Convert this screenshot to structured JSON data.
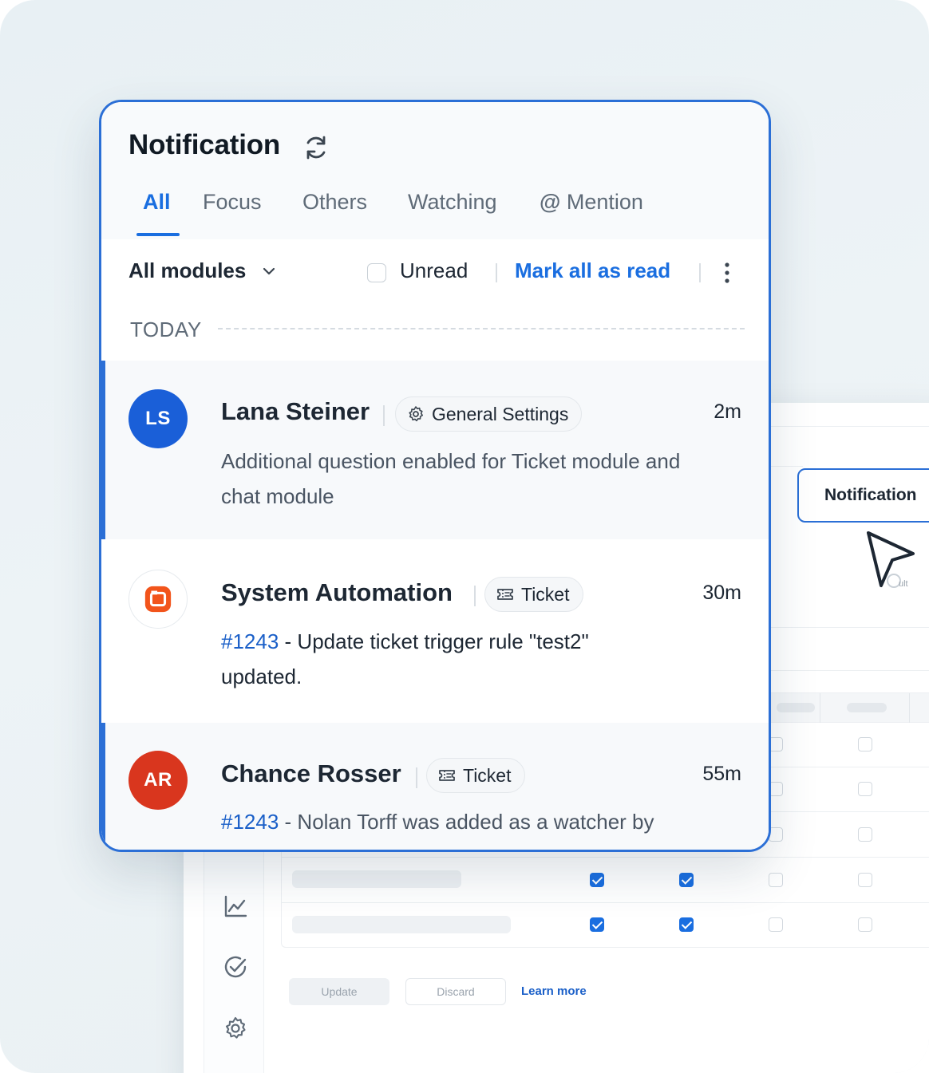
{
  "panel": {
    "title": "Notification",
    "tabs": [
      "All",
      "Focus",
      "Others",
      "Watching",
      "Mention"
    ],
    "active_tab": "All",
    "filter": {
      "modules_label": "All modules",
      "unread_label": "Unread",
      "mark_all_label": "Mark all as read"
    },
    "section_label": "TODAY",
    "notifications": [
      {
        "initials": "LS",
        "name": "Lana Steiner",
        "chip": "General Settings",
        "chip_icon": "gear-icon",
        "time": "2m",
        "message": "Additional question enabled for Ticket module and chat module",
        "unread": true,
        "avatar_color": "#1a5fd8"
      },
      {
        "initials": "",
        "name": "System Automation",
        "chip": "Ticket",
        "chip_icon": "ticket-icon",
        "time": "30m",
        "ticket": "#1243",
        "message": " - Update ticket trigger rule \"test2\" updated.",
        "unread": false,
        "avatar_icon": "system-automation-logo"
      },
      {
        "initials": "AR",
        "name": "Chance Rosser",
        "chip": "Ticket",
        "chip_icon": "ticket-icon",
        "time": "55m",
        "ticket": "#1243",
        "message": " - Nolan Torff was added as a watcher by",
        "unread": true,
        "avatar_color": "#d9361e"
      }
    ]
  },
  "background": {
    "notification_button": "Notification",
    "slider_end_text": "ult",
    "update_button": "Update",
    "discard_button": "Discard",
    "learn_more": "Learn more"
  },
  "colors": {
    "accent": "#1a6ee0",
    "panel_border": "#2b6fd6",
    "orange_logo": "#f2541b"
  }
}
